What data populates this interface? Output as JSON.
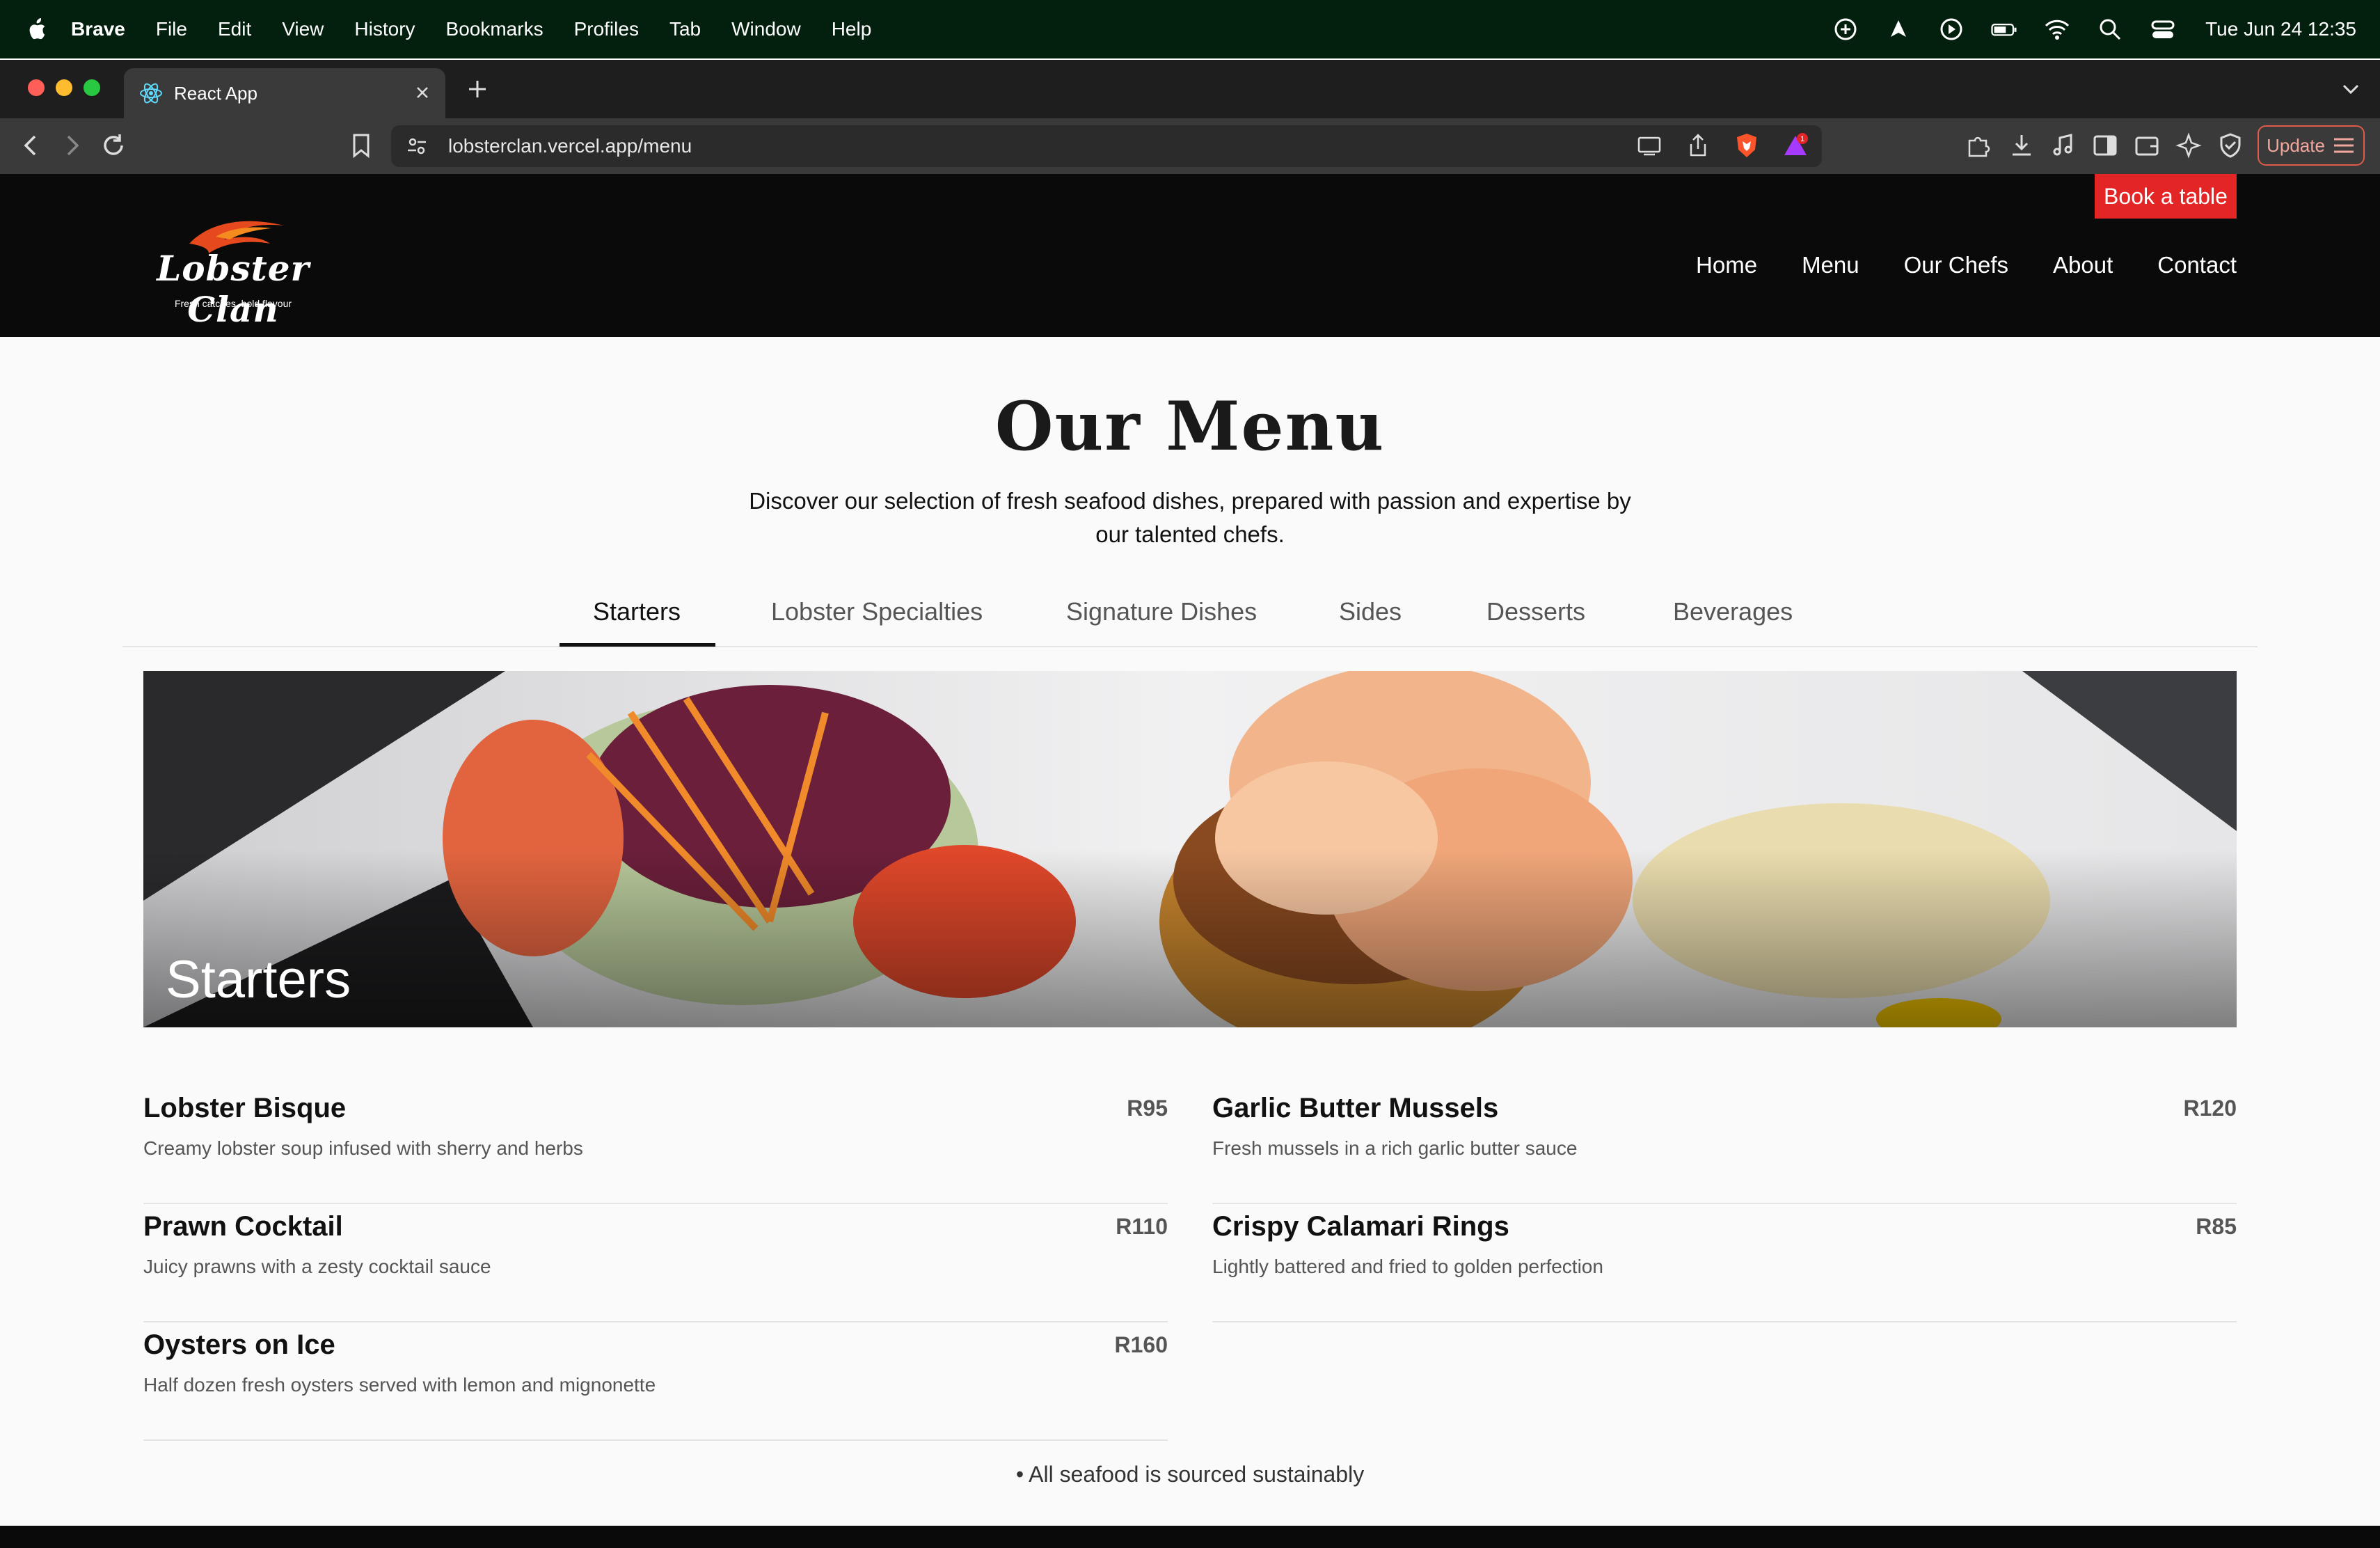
{
  "macos_menubar": {
    "items": [
      "Brave",
      "File",
      "Edit",
      "View",
      "History",
      "Bookmarks",
      "Profiles",
      "Tab",
      "Window",
      "Help"
    ],
    "clock": "Tue Jun 24  12:35"
  },
  "browser": {
    "tab_title": "React App",
    "url": "lobsterclan.vercel.app/menu",
    "update_label": "Update",
    "notification_count": "1"
  },
  "site": {
    "logo_text": "Lobster Clan",
    "logo_tagline": "Fresh catches, bold flavour",
    "book_button": "Book a table",
    "nav": [
      "Home",
      "Menu",
      "Our Chefs",
      "About",
      "Contact"
    ]
  },
  "menu_page": {
    "title": "Our Menu",
    "intro": "Discover our selection of fresh seafood dishes, prepared with passion and expertise by our talented chefs.",
    "tabs": [
      "Starters",
      "Lobster Specialties",
      "Signature Dishes",
      "Sides",
      "Desserts",
      "Beverages"
    ],
    "active_tab": "Starters",
    "hero_label": "Starters",
    "items": [
      {
        "name": "Lobster Bisque",
        "price": "R95",
        "desc": "Creamy lobster soup infused with sherry and herbs"
      },
      {
        "name": "Garlic Butter Mussels",
        "price": "R120",
        "desc": "Fresh mussels in a rich garlic butter sauce"
      },
      {
        "name": "Prawn Cocktail",
        "price": "R110",
        "desc": "Juicy prawns with a zesty cocktail sauce"
      },
      {
        "name": "Crispy Calamari Rings",
        "price": "R85",
        "desc": "Lightly battered and fried to golden perfection"
      },
      {
        "name": "Oysters on Ice",
        "price": "R160",
        "desc": "Half dozen fresh oysters served with lemon and mignonette"
      }
    ],
    "footnote": "• All seafood is sourced sustainably"
  },
  "colors": {
    "accent_red": "#e32525",
    "header_bg": "#0a0a0a",
    "menubar_bg": "#03200f"
  }
}
